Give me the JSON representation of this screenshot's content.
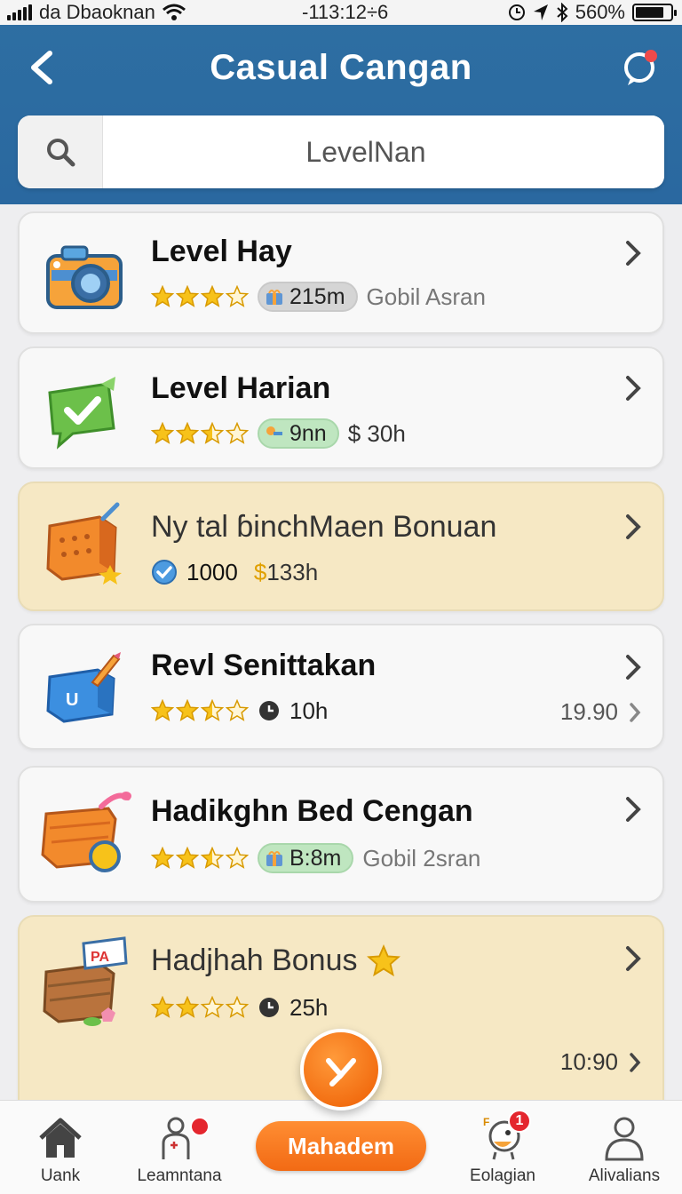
{
  "status_bar": {
    "carrier": "da Dbaoknan",
    "time": "-113:12÷6",
    "battery": "560%",
    "battery_level": 0.82
  },
  "header": {
    "title": "Casual Cangan",
    "search_placeholder": "LevelNan"
  },
  "cards": [
    {
      "title": "Level Hay",
      "stars": 3,
      "pill": "215m",
      "pill_style": "gray",
      "sub": "Gobil Asran"
    },
    {
      "title": "Level Harian",
      "stars": 2.5,
      "pill": "9nn",
      "pill_style": "green",
      "sub": "30h"
    },
    {
      "title": "Ny tal ɓinchMaen Bonuan",
      "coins": "1000",
      "time": "133h"
    },
    {
      "title": "Revl Senittakan",
      "stars": 2.5,
      "time": "10h",
      "value": "19.90"
    },
    {
      "title": "Hadikghn Bed Cengan",
      "stars": 2.5,
      "pill": "B:8m",
      "pill_style": "green",
      "sub": "Gobil 2sran"
    },
    {
      "title": "Hadjhah Bonus",
      "stars": 2,
      "time": "25h",
      "value": "10:90"
    }
  ],
  "tabbar": {
    "tabs": [
      {
        "label": "Uank"
      },
      {
        "label": "Leamntana",
        "badge": ""
      },
      {
        "label": "Eolagian",
        "badge": "1"
      },
      {
        "label": "Alivalians"
      }
    ],
    "center_button": "Mahadem"
  },
  "colors": {
    "header_blue": "#2e6fa2",
    "highlight_card": "#f6e8c4",
    "accent_orange": "#f26c10",
    "badge_red": "#e4262e"
  }
}
